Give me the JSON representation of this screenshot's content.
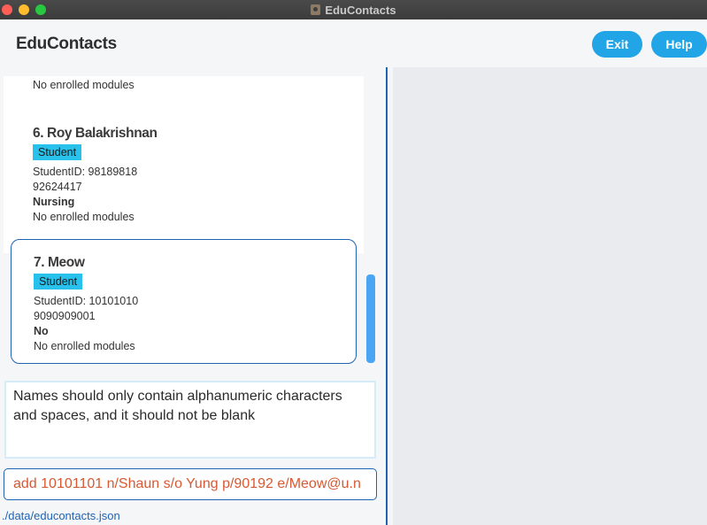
{
  "window": {
    "title": "EduContacts"
  },
  "header": {
    "brand": "EduContacts",
    "exit_label": "Exit",
    "help_label": "Help"
  },
  "persons": [
    {
      "modules": "No enrolled modules"
    },
    {
      "name": "6. Roy Balakrishnan",
      "tag": "Student",
      "student_id": "StudentID: 98189818",
      "phone": "92624417",
      "course": "Nursing",
      "modules": "No enrolled modules"
    },
    {
      "name": "7. Meow",
      "tag": "Student",
      "student_id": "StudentID: 10101010",
      "phone": "9090909001",
      "course": "No",
      "modules": "No enrolled modules"
    }
  ],
  "result": {
    "message": "Names should only contain alphanumeric characters and spaces, and it should not be blank"
  },
  "command": {
    "value": "add 10101101 n/Shaun s/o Yung p/90192 e/Meow@u.n"
  },
  "status": {
    "file_path": "./data/educontacts.json"
  }
}
